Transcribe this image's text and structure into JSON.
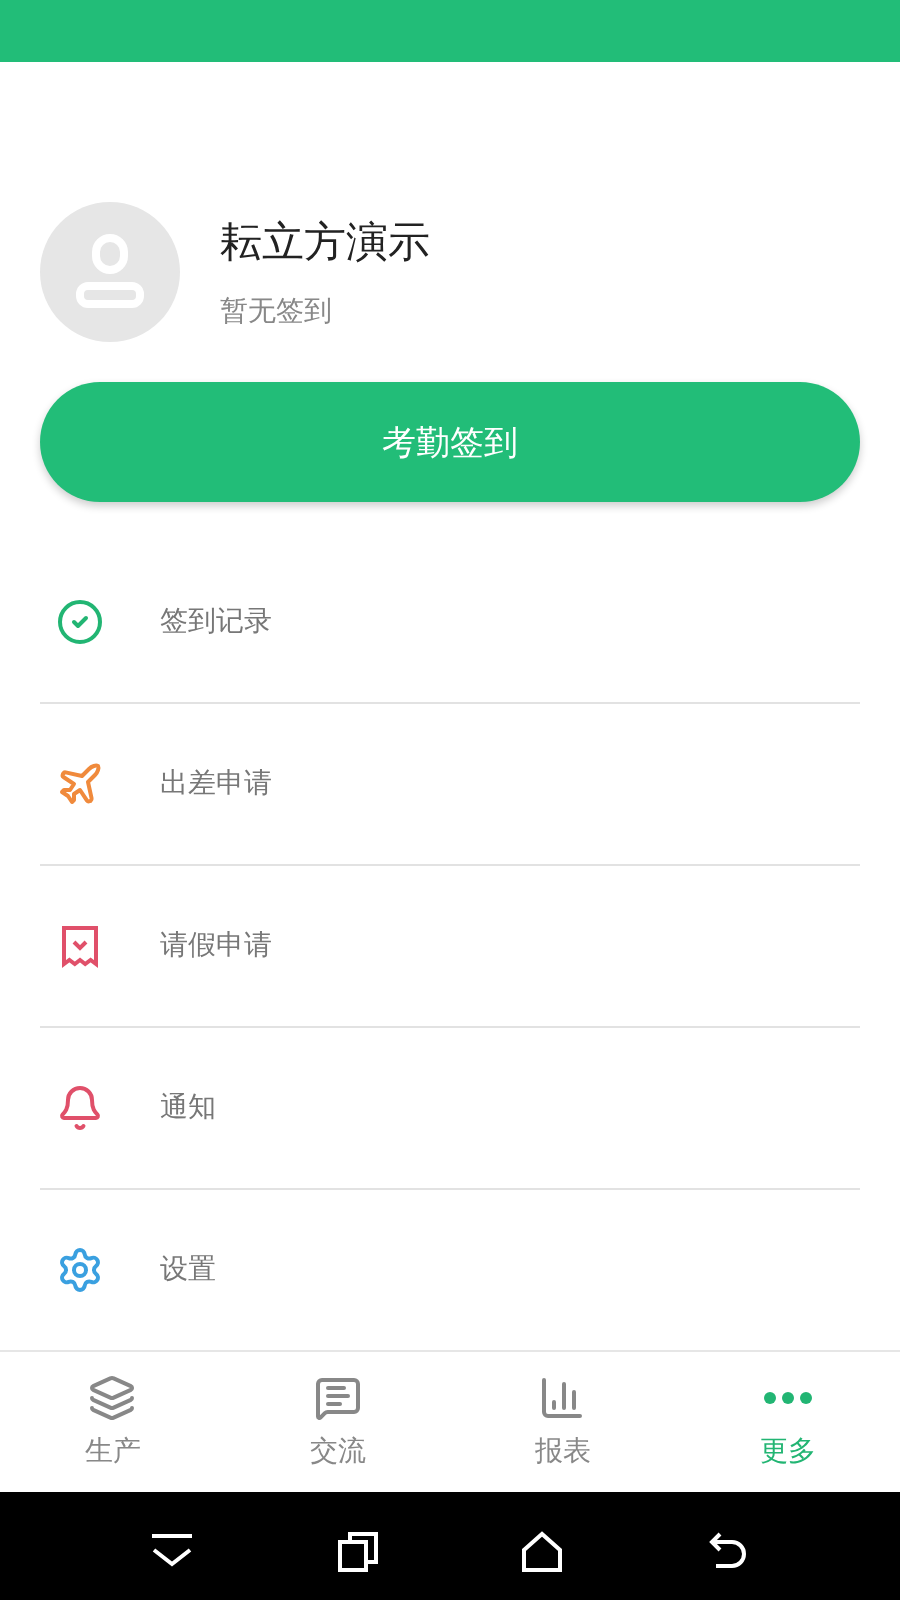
{
  "profile": {
    "name": "耘立方演示",
    "status": "暂无签到"
  },
  "checkin_button": "考勤签到",
  "menu": [
    {
      "kind": "check",
      "label": "签到记录",
      "color": "#22b573"
    },
    {
      "kind": "plane",
      "label": "出差申请",
      "color": "#f08a3c"
    },
    {
      "kind": "receipt",
      "label": "请假申请",
      "color": "#e0506a"
    },
    {
      "kind": "bell",
      "label": "通知",
      "color": "#e0506a"
    },
    {
      "kind": "gear",
      "label": "设置",
      "color": "#3aa0e0"
    }
  ],
  "tabs": [
    {
      "kind": "layers",
      "label": "生产",
      "selected": false
    },
    {
      "kind": "chat",
      "label": "交流",
      "selected": false
    },
    {
      "kind": "chart",
      "label": "报表",
      "selected": false
    },
    {
      "kind": "more",
      "label": "更多",
      "selected": true
    }
  ]
}
